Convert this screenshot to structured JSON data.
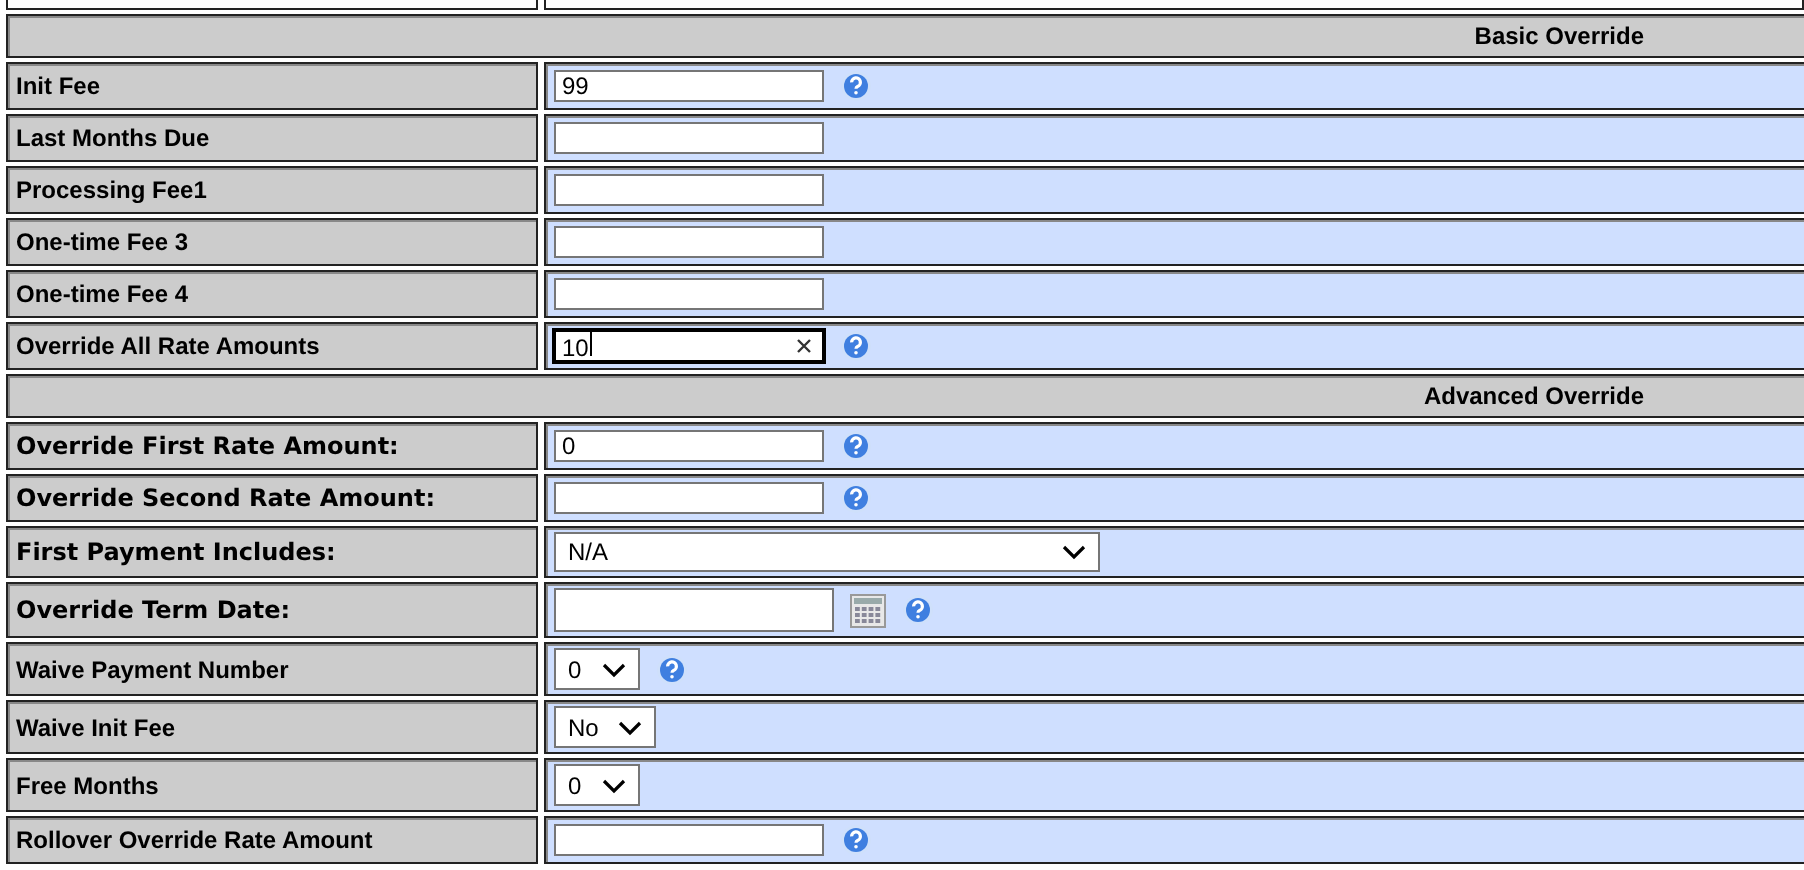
{
  "sections": [
    {
      "title": "Basic Override",
      "rows": [
        {
          "label": "Init Fee",
          "bold": false,
          "kind": "text",
          "value": "99",
          "focused": false,
          "help": true
        },
        {
          "label": "Last Months Due",
          "bold": false,
          "kind": "text",
          "focused": false,
          "help": false
        },
        {
          "label": "Processing Fee1",
          "bold": false,
          "kind": "text",
          "focused": false,
          "help": false
        },
        {
          "label": "One-time Fee 3",
          "bold": false,
          "kind": "text",
          "focused": false,
          "help": false
        },
        {
          "label": "One-time Fee 4",
          "bold": false,
          "kind": "text",
          "focused": false,
          "help": false
        },
        {
          "label": "Override All Rate Amounts",
          "bold": false,
          "kind": "text",
          "value": "10",
          "focused": true,
          "help": true
        }
      ]
    },
    {
      "title": "Advanced Override",
      "rows": [
        {
          "label": "Override First Rate Amount:",
          "bold": true,
          "kind": "text",
          "value": "0",
          "focused": false,
          "help": true
        },
        {
          "label": "Override Second Rate Amount:",
          "bold": true,
          "kind": "text",
          "focused": false,
          "help": true
        },
        {
          "label": "First Payment Includes:",
          "bold": true,
          "kind": "wide-select",
          "value": "N/A",
          "help": false
        },
        {
          "label": "Override Term Date:",
          "bold": true,
          "kind": "date",
          "focused": false,
          "help": true
        },
        {
          "label": "Waive Payment Number",
          "bold": false,
          "kind": "select",
          "value": "0",
          "help": true
        },
        {
          "label": "Waive Init Fee",
          "bold": false,
          "kind": "select",
          "value": "No",
          "help": false
        },
        {
          "label": "Free Months",
          "bold": false,
          "kind": "select",
          "value": "0",
          "help": false
        },
        {
          "label": "Rollover Override Rate Amount",
          "bold": false,
          "kind": "text",
          "focused": false,
          "help": true
        }
      ]
    }
  ]
}
